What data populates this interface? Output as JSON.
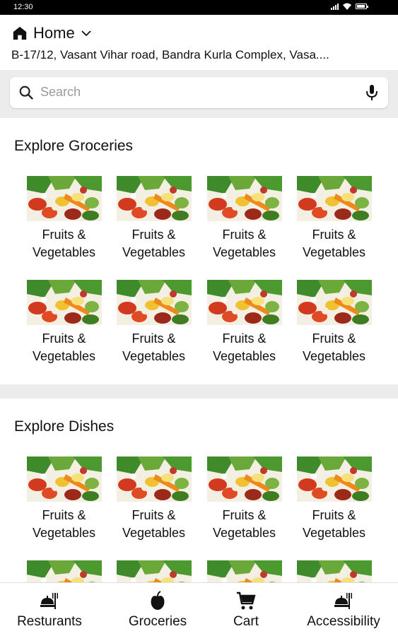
{
  "status_bar": {
    "time": "12:30"
  },
  "header": {
    "location_icon": "home-icon",
    "location_title": "Home",
    "dropdown_icon": "chevron-down-icon",
    "address": "B-17/12, Vasant Vihar road, Bandra Kurla Complex, Vasa...."
  },
  "search": {
    "placeholder": "Search",
    "left_icon": "search-icon",
    "right_icon": "microphone-icon"
  },
  "groceries": {
    "title": "Explore Groceries",
    "items": [
      {
        "label": "Fruits &\nVegetables"
      },
      {
        "label": "Fruits &\nVegetables"
      },
      {
        "label": "Fruits &\nVegetables"
      },
      {
        "label": "Fruits &\nVegetables"
      },
      {
        "label": "Fruits &\nVegetables"
      },
      {
        "label": "Fruits &\nVegetables"
      },
      {
        "label": "Fruits &\nVegetables"
      },
      {
        "label": "Fruits &\nVegetables"
      }
    ]
  },
  "dishes": {
    "title": "Explore Dishes",
    "items": [
      {
        "label": "Fruits &\nVegetables"
      },
      {
        "label": "Fruits &\nVegetables"
      },
      {
        "label": "Fruits &\nVegetables"
      },
      {
        "label": "Fruits &\nVegetables"
      },
      {
        "label": ""
      },
      {
        "label": ""
      },
      {
        "label": ""
      },
      {
        "label": ""
      }
    ]
  },
  "bottom_nav": {
    "items": [
      {
        "label": "Resturants",
        "icon": "restaurant-icon"
      },
      {
        "label": "Groceries",
        "icon": "apple-icon"
      },
      {
        "label": "Cart",
        "icon": "cart-icon"
      },
      {
        "label": "Accessibility",
        "icon": "restaurant-icon"
      }
    ]
  }
}
